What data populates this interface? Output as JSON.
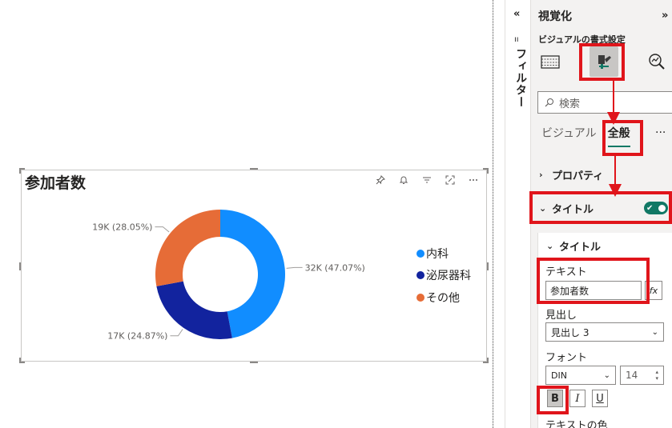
{
  "visual": {
    "title": "参加者数",
    "legend": [
      {
        "label": "内科",
        "color": "#118dff"
      },
      {
        "label": "泌尿器科",
        "color": "#12239e"
      },
      {
        "label": "その他",
        "color": "#e66c37"
      }
    ]
  },
  "chart_data": {
    "type": "pie",
    "donut": true,
    "categories": [
      "内科",
      "泌尿器科",
      "その他"
    ],
    "values": [
      32,
      17,
      19
    ],
    "percentages": [
      47.07,
      24.87,
      28.05
    ],
    "data_labels": [
      "32K (47.07%)",
      "17K (24.87%)",
      "19K (28.05%)"
    ],
    "colors": [
      "#118dff",
      "#12239e",
      "#e66c37"
    ],
    "title": "参加者数",
    "legend_position": "right"
  },
  "filter_pane": {
    "label": "フィルター"
  },
  "pane": {
    "title": "視覚化",
    "collapse_icon": "«",
    "expand_icon": "»",
    "subtitle": "ビジュアルの書式設定",
    "search_placeholder": "検索",
    "tabs": [
      {
        "label": "ビジュアル"
      },
      {
        "label": "全般"
      }
    ],
    "more": "···",
    "sections": {
      "properties": "プロパティ",
      "title": "タイトル"
    },
    "title_card": {
      "header": "タイトル",
      "text_label": "テキスト",
      "text_value": "参加者数",
      "fx": "fx",
      "heading_label": "見出し",
      "heading_value": "見出し 3",
      "font_label": "フォント",
      "font_value": "DIN",
      "font_size": "14",
      "bold": "B",
      "italic": "I",
      "underline": "U",
      "text_color_label": "テキストの色"
    }
  }
}
